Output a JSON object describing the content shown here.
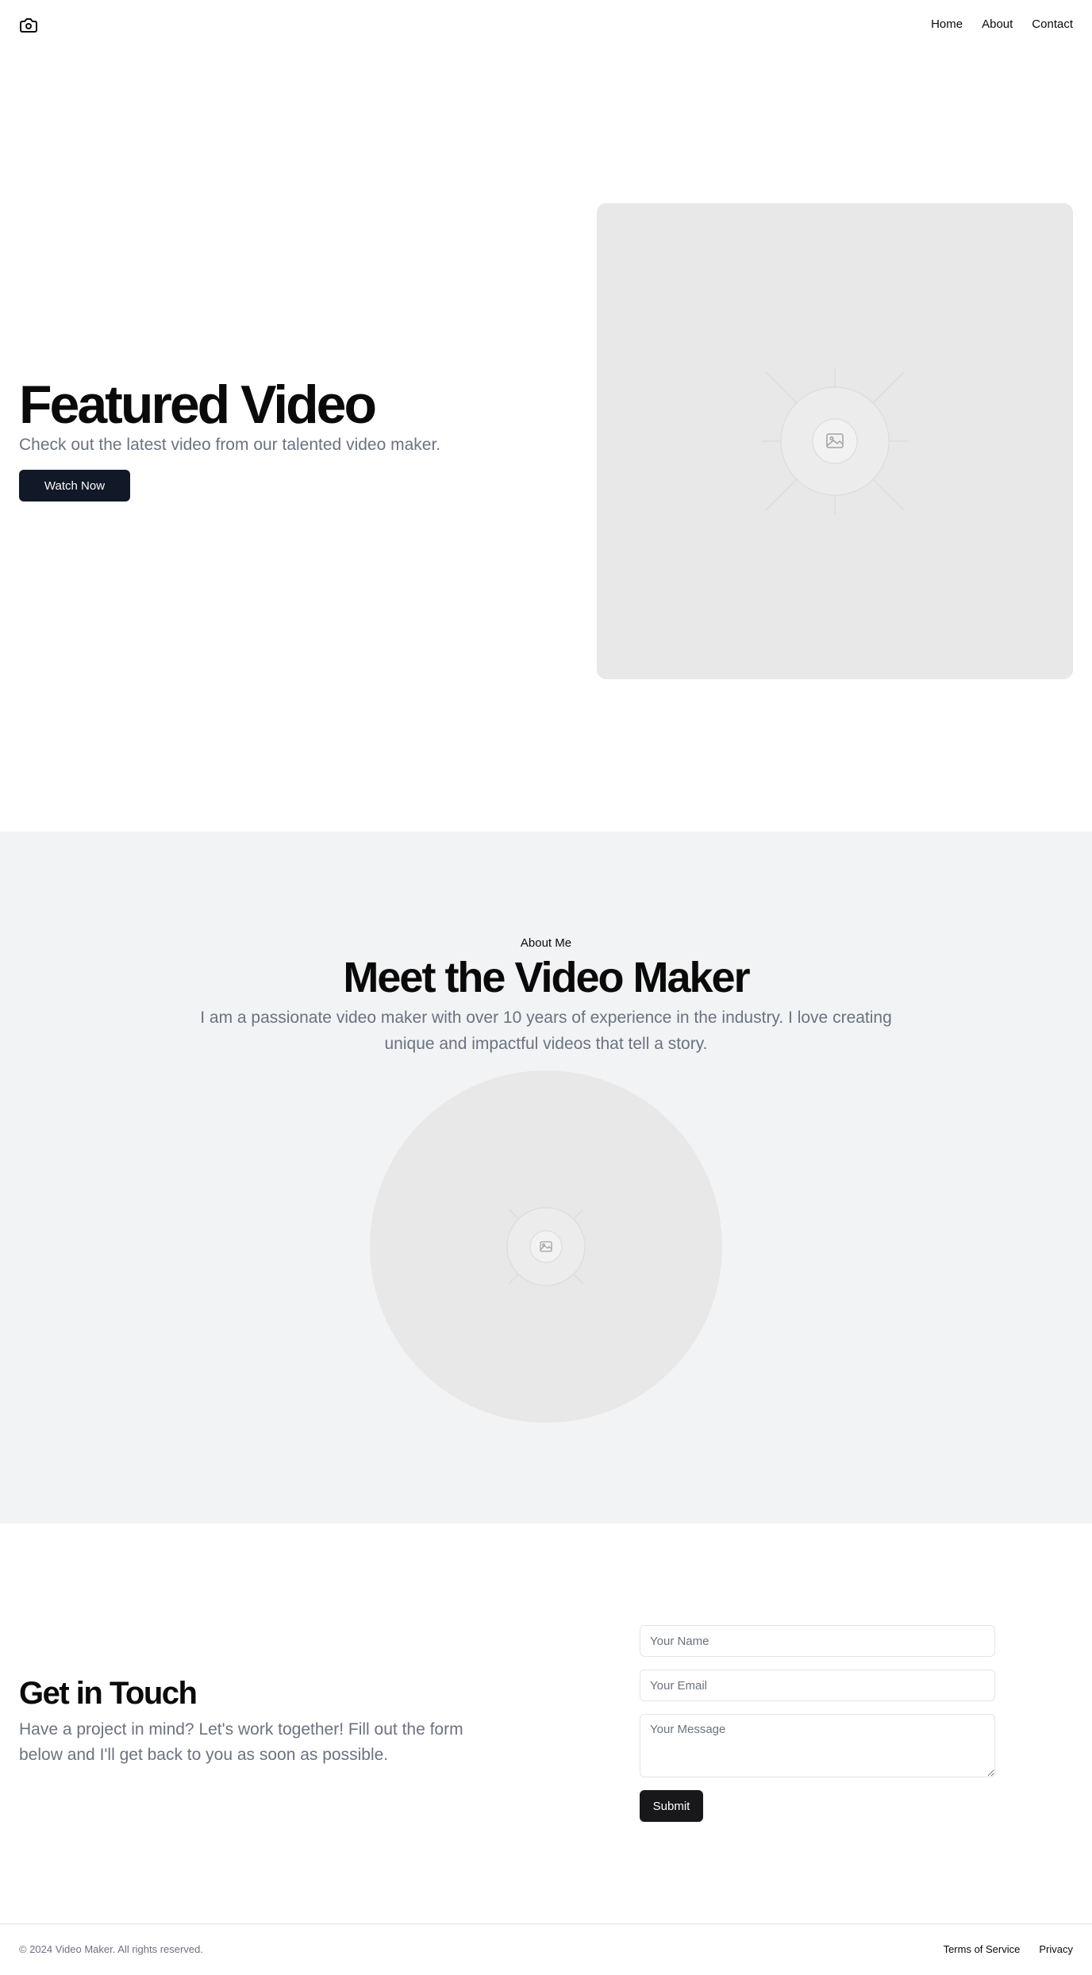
{
  "header": {
    "logo_icon": "camera-icon",
    "nav": [
      {
        "label": "Home"
      },
      {
        "label": "About"
      },
      {
        "label": "Contact"
      }
    ]
  },
  "hero": {
    "title": "Featured Video",
    "subtitle": "Check out the latest video from our talented video maker.",
    "button_label": "Watch Now",
    "media_icon": "image-placeholder-icon"
  },
  "about": {
    "eyebrow": "About Me",
    "title": "Meet the Video Maker",
    "text": "I am a passionate video maker with over 10 years of experience in the industry. I love creating unique and impactful videos that tell a story.",
    "media_icon": "image-placeholder-icon"
  },
  "contact": {
    "title": "Get in Touch",
    "text": "Have a project in mind? Let's work together! Fill out the form below and I'll get back to you as soon as possible.",
    "name_placeholder": "Your Name",
    "email_placeholder": "Your Email",
    "message_placeholder": "Your Message",
    "submit_label": "Submit"
  },
  "footer": {
    "copyright": "© 2024 Video Maker. All rights reserved.",
    "links": [
      {
        "label": "Terms of Service"
      },
      {
        "label": "Privacy"
      }
    ]
  },
  "colors": {
    "primary_button": "#111827",
    "submit_button": "#18181b",
    "muted_text": "#6b7280",
    "about_background": "#f2f3f5",
    "placeholder_fill": "#e8e8e8"
  }
}
